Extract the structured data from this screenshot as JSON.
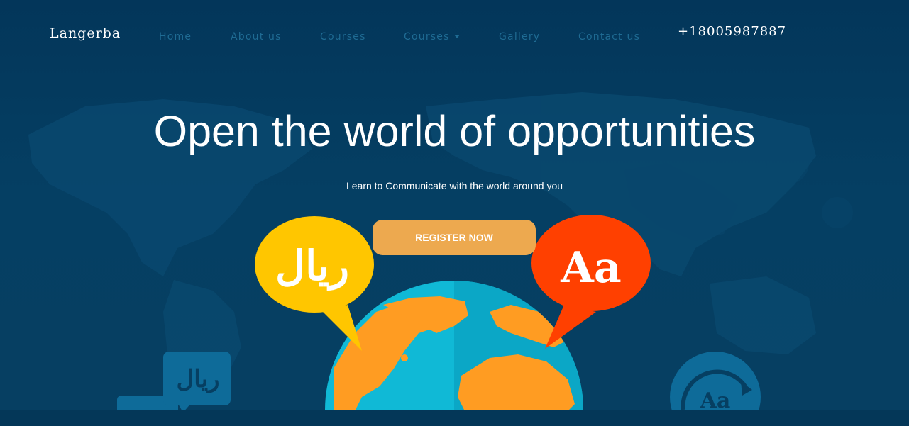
{
  "brand": "Langerba",
  "nav": {
    "items": [
      {
        "label": "Home"
      },
      {
        "label": "About us"
      },
      {
        "label": "Courses"
      },
      {
        "label": "Courses",
        "has_dropdown": true
      },
      {
        "label": "Gallery"
      },
      {
        "label": "Contact us"
      }
    ],
    "phone": "+18005987887"
  },
  "hero": {
    "title": "Open the world of opportunities",
    "subtitle": "Learn to Communicate with the world around you",
    "cta_label": "REGISTER NOW"
  },
  "illustration": {
    "left_bubble_text": "ريال",
    "right_bubble_text": "Aa",
    "small_left_text": "ريال",
    "small_right_text": "Aa"
  },
  "colors": {
    "background": "#043758",
    "nav_link": "#1f6b93",
    "cta": "#eda94f",
    "bubble_yellow": "#ffc600",
    "bubble_red": "#ff4000",
    "globe_ocean": "#10b9d6",
    "globe_land": "#ff9c22"
  },
  "icons": [
    "dropdown-caret-icon",
    "speech-bubble-icon",
    "globe-icon",
    "translate-circle-icon"
  ]
}
